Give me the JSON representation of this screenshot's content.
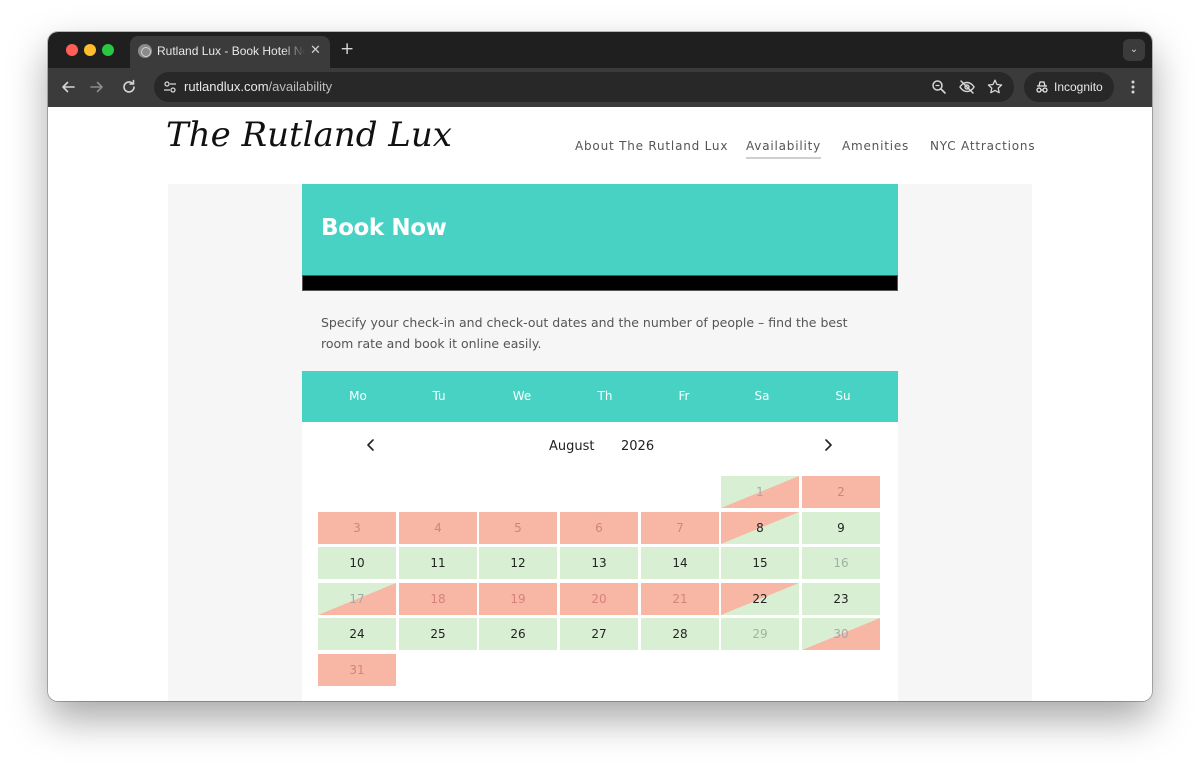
{
  "browser": {
    "tab_title": "Rutland Lux - Book Hotel Now",
    "tab_close": "✕",
    "new_tab": "+",
    "tab_menu": "⌄",
    "url_host": "rutlandlux.com",
    "url_path": "/availability",
    "incognito_label": "Incognito"
  },
  "site": {
    "logo": "The Rutland Lux",
    "nav": [
      {
        "label": "About The Rutland Lux",
        "active": false
      },
      {
        "label": "Availability",
        "active": true
      },
      {
        "label": "Amenities",
        "active": false
      },
      {
        "label": "NYC Attractions",
        "active": false
      }
    ]
  },
  "hero": {
    "title": "Book Now"
  },
  "intro": {
    "text": "Specify your check-in and check-out dates and the number of people – find the best room rate and book it online easily."
  },
  "calendar": {
    "weekdays": [
      "Mo",
      "Tu",
      "We",
      "Th",
      "Fr",
      "Sa",
      "Su"
    ],
    "month": "August",
    "year": "2026",
    "prev": "‹",
    "next": "›",
    "first_weekday_index": 5,
    "days": [
      {
        "d": "1",
        "s": "past-checkin"
      },
      {
        "d": "2",
        "s": "booked"
      },
      {
        "d": "3",
        "s": "booked"
      },
      {
        "d": "4",
        "s": "booked"
      },
      {
        "d": "5",
        "s": "booked"
      },
      {
        "d": "6",
        "s": "booked"
      },
      {
        "d": "7",
        "s": "booked"
      },
      {
        "d": "8",
        "s": "checkout"
      },
      {
        "d": "9",
        "s": "avail"
      },
      {
        "d": "10",
        "s": "avail"
      },
      {
        "d": "11",
        "s": "avail"
      },
      {
        "d": "12",
        "s": "avail"
      },
      {
        "d": "13",
        "s": "avail"
      },
      {
        "d": "14",
        "s": "avail"
      },
      {
        "d": "15",
        "s": "avail"
      },
      {
        "d": "16",
        "s": "past-avail"
      },
      {
        "d": "17",
        "s": "past-checkin"
      },
      {
        "d": "18",
        "s": "booked"
      },
      {
        "d": "19",
        "s": "booked"
      },
      {
        "d": "20",
        "s": "booked"
      },
      {
        "d": "21",
        "s": "booked"
      },
      {
        "d": "22",
        "s": "checkout"
      },
      {
        "d": "23",
        "s": "avail"
      },
      {
        "d": "24",
        "s": "avail"
      },
      {
        "d": "25",
        "s": "avail"
      },
      {
        "d": "26",
        "s": "avail"
      },
      {
        "d": "27",
        "s": "avail"
      },
      {
        "d": "28",
        "s": "avail"
      },
      {
        "d": "29",
        "s": "past-avail"
      },
      {
        "d": "30",
        "s": "past-checkin"
      },
      {
        "d": "31",
        "s": "booked"
      }
    ],
    "colors": {
      "header": "#48d2c4",
      "available": "#d9efd4",
      "booked": "#f8b7a4"
    }
  }
}
